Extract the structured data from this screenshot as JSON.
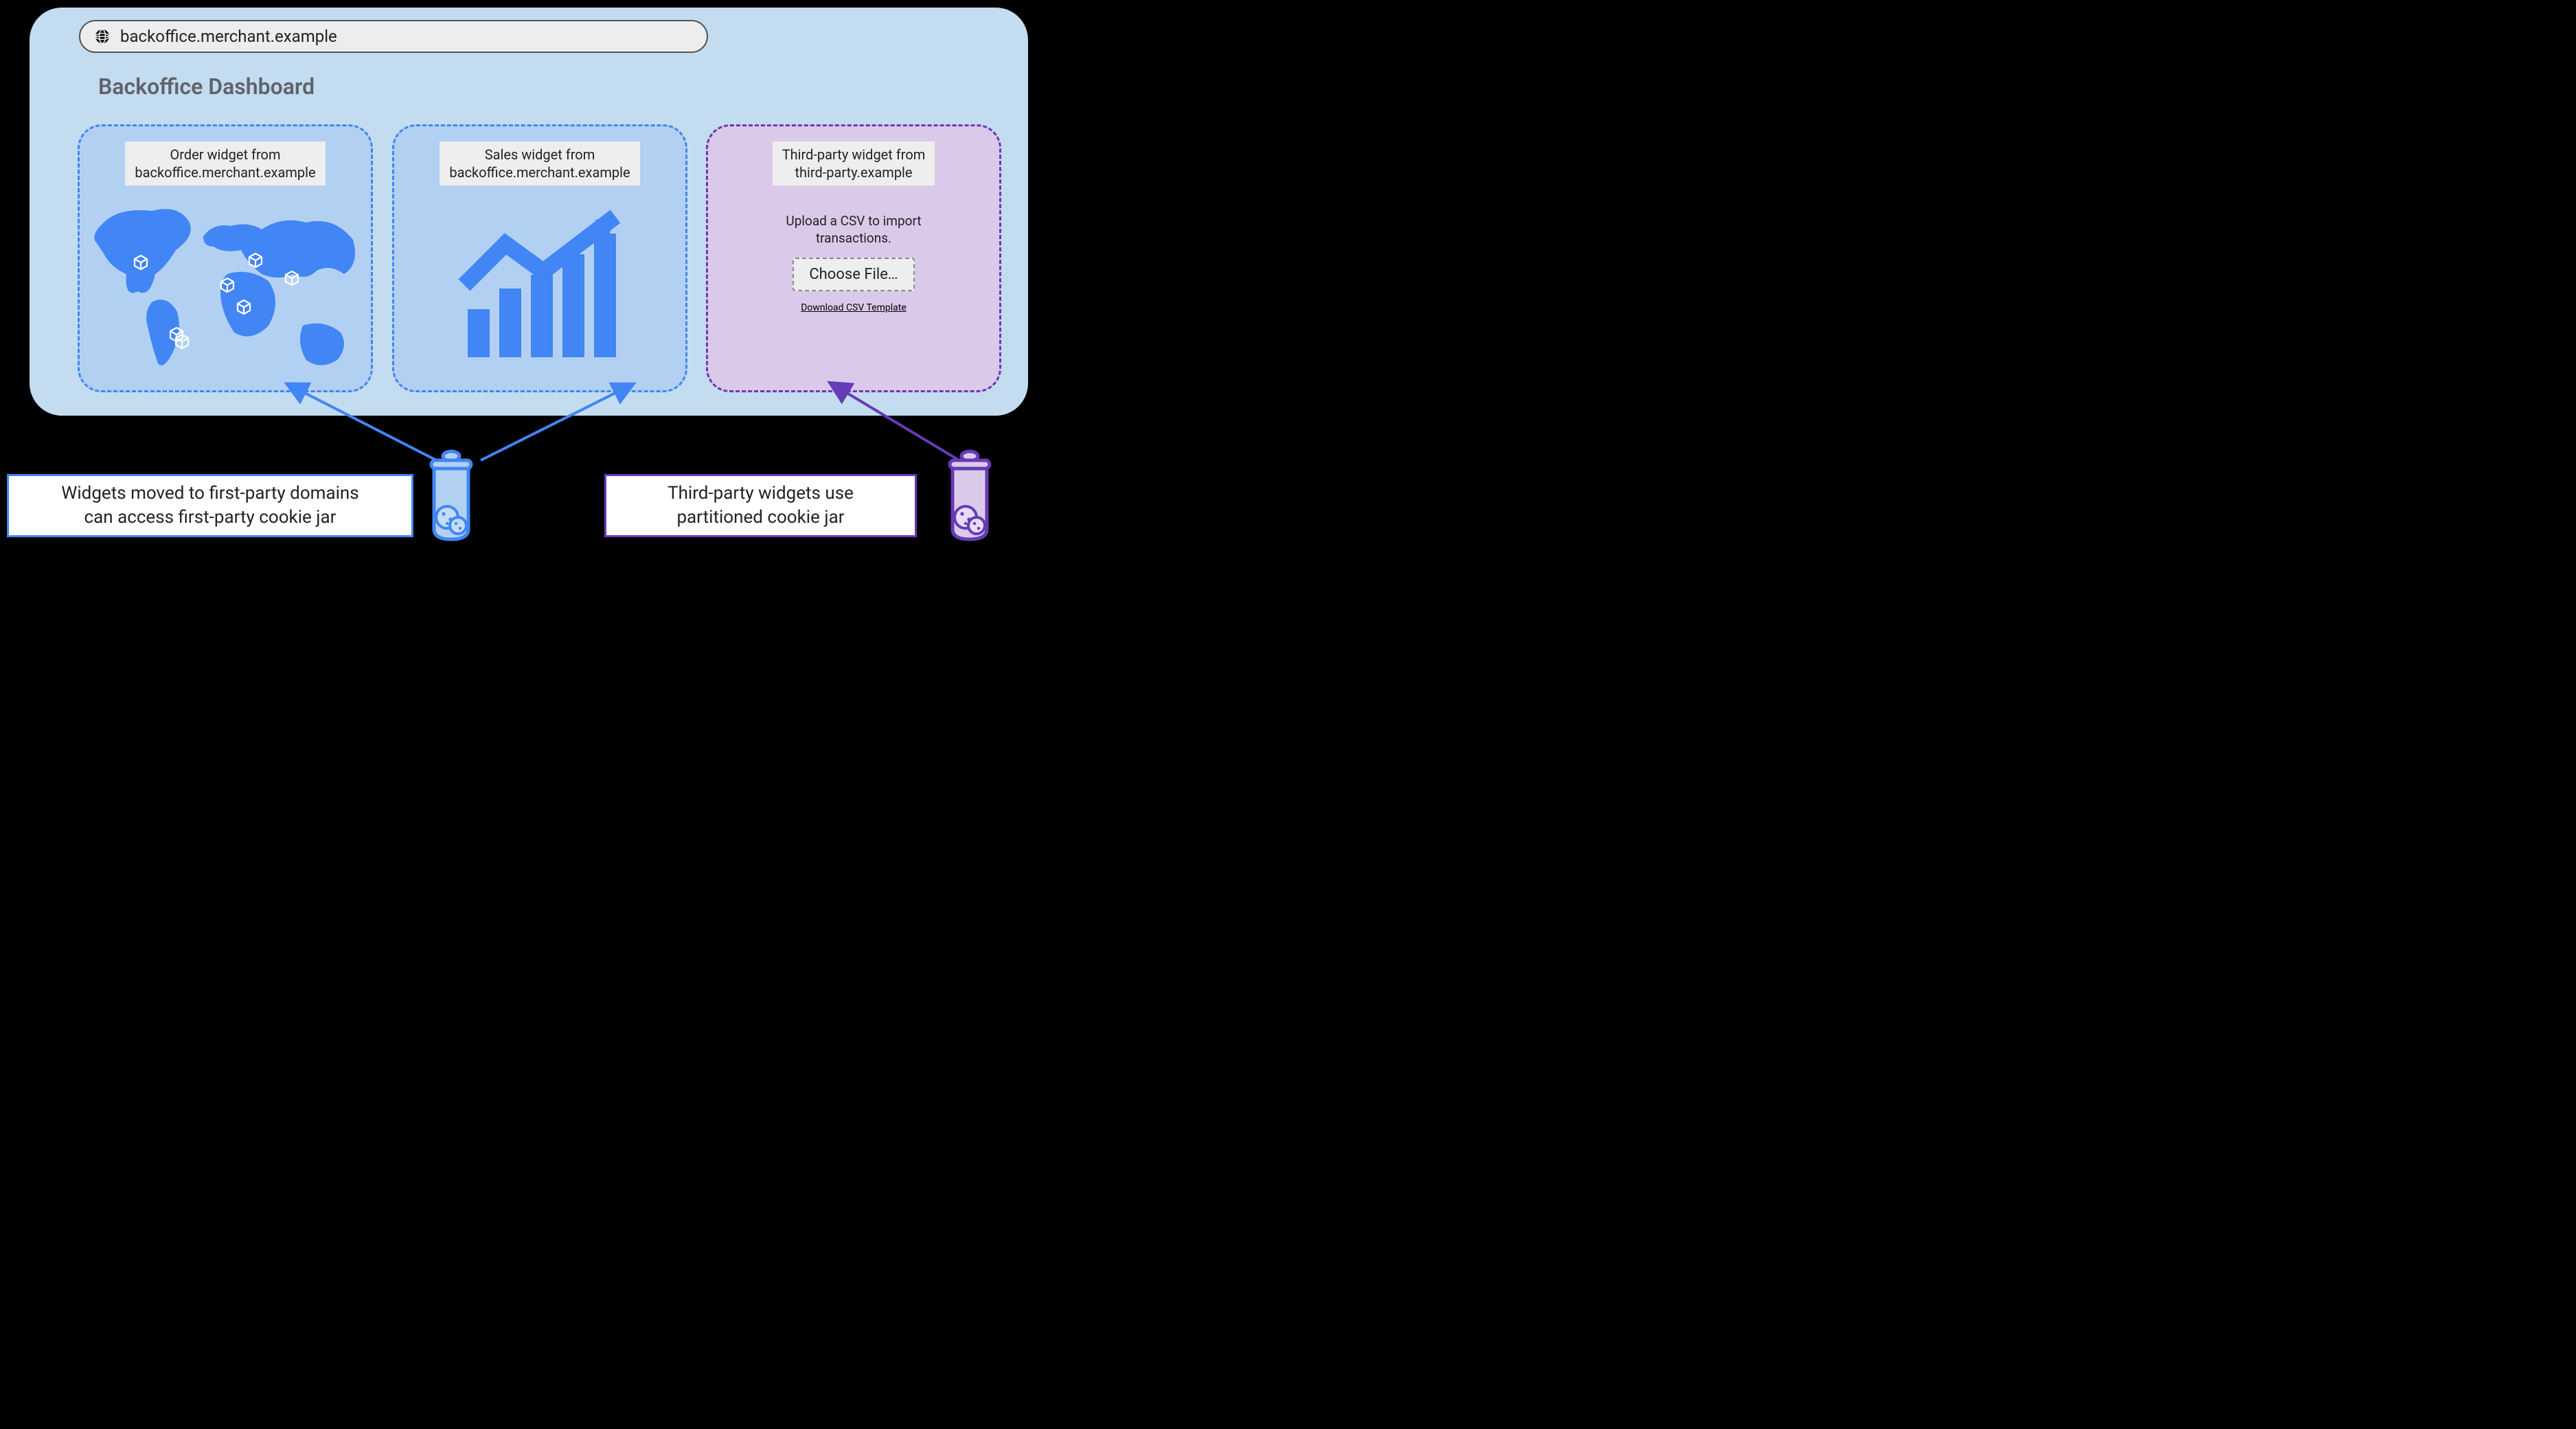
{
  "address_bar": {
    "url": "backoffice.merchant.example"
  },
  "page_title": "Backoffice Dashboard",
  "widgets": {
    "order": {
      "label": "Order widget from\nbackoffice.merchant.example"
    },
    "sales": {
      "label": "Sales widget from\nbackoffice.merchant.example"
    },
    "third": {
      "label": "Third-party widget from\nthird-party.example",
      "upload_text": "Upload a CSV to import\ntransactions.",
      "choose_file_label": "Choose File…",
      "download_link_label": "Download CSV Template"
    }
  },
  "captions": {
    "first_party": "Widgets moved to first-party domains\ncan access first-party cookie jar",
    "third_party": "Third-party widgets use\npartitioned cookie jar"
  },
  "colors": {
    "first_party": "#4285f4",
    "third_party": "#673ab7"
  },
  "jars": {
    "first_party_name": "first-party-cookie-jar",
    "third_party_name": "partitioned-cookie-jar"
  }
}
